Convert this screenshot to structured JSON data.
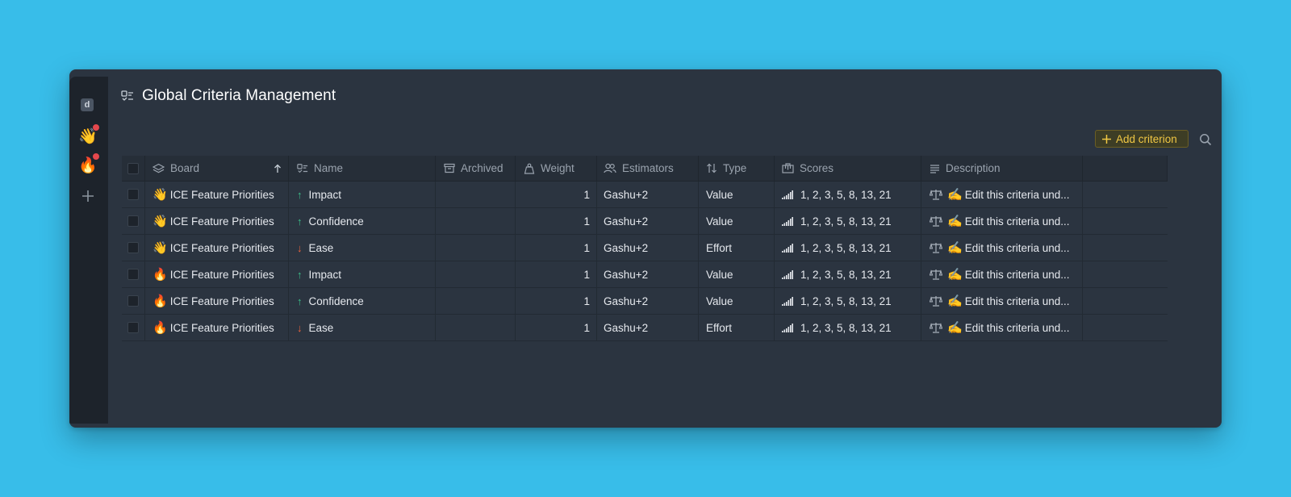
{
  "sidebar": {
    "logo_letter": "d",
    "boards": [
      {
        "emoji": "👋",
        "has_notification": true
      },
      {
        "emoji": "🔥",
        "has_notification": true
      }
    ]
  },
  "header": {
    "title": "Global Criteria Management"
  },
  "toolbar": {
    "add_label": "Add criterion"
  },
  "table": {
    "columns": {
      "board": "Board",
      "name": "Name",
      "archived": "Archived",
      "weight": "Weight",
      "estimators": "Estimators",
      "type": "Type",
      "scores": "Scores",
      "description": "Description"
    },
    "rows": [
      {
        "board_emoji": "👋",
        "board": "ICE Feature Priorities",
        "direction": "up",
        "name": "Impact",
        "archived": "",
        "weight": "1",
        "estimators": "Gashu+2",
        "type": "Value",
        "scores": "1, 2, 3, 5, 8, 13, 21",
        "desc_emoji": "✍️",
        "description": "Edit this criteria und..."
      },
      {
        "board_emoji": "👋",
        "board": "ICE Feature Priorities",
        "direction": "up",
        "name": "Confidence",
        "archived": "",
        "weight": "1",
        "estimators": "Gashu+2",
        "type": "Value",
        "scores": "1, 2, 3, 5, 8, 13, 21",
        "desc_emoji": "✍️",
        "description": "Edit this criteria und..."
      },
      {
        "board_emoji": "👋",
        "board": "ICE Feature Priorities",
        "direction": "down",
        "name": "Ease",
        "archived": "",
        "weight": "1",
        "estimators": "Gashu+2",
        "type": "Effort",
        "scores": "1, 2, 3, 5, 8, 13, 21",
        "desc_emoji": "✍️",
        "description": "Edit this criteria und..."
      },
      {
        "board_emoji": "🔥",
        "board": "ICE Feature Priorities",
        "direction": "up",
        "name": "Impact",
        "archived": "",
        "weight": "1",
        "estimators": "Gashu+2",
        "type": "Value",
        "scores": "1, 2, 3, 5, 8, 13, 21",
        "desc_emoji": "✍️",
        "description": "Edit this criteria und..."
      },
      {
        "board_emoji": "🔥",
        "board": "ICE Feature Priorities",
        "direction": "up",
        "name": "Confidence",
        "archived": "",
        "weight": "1",
        "estimators": "Gashu+2",
        "type": "Value",
        "scores": "1, 2, 3, 5, 8, 13, 21",
        "desc_emoji": "✍️",
        "description": "Edit this criteria und..."
      },
      {
        "board_emoji": "🔥",
        "board": "ICE Feature Priorities",
        "direction": "down",
        "name": "Ease",
        "archived": "",
        "weight": "1",
        "estimators": "Gashu+2",
        "type": "Effort",
        "scores": "1, 2, 3, 5, 8, 13, 21",
        "desc_emoji": "✍️",
        "description": "Edit this criteria und..."
      }
    ]
  },
  "colors": {
    "background": "#38bde9",
    "panel": "#2b3440",
    "rail": "#1d232b",
    "accent": "#f0c744",
    "arrow_up": "#3cc08a",
    "arrow_down": "#f0643c",
    "notification": "#e5484d"
  },
  "icons": {
    "board_column": "layers-icon",
    "name_column": "criteria-icon",
    "archived_column": "archive-box-icon",
    "weight_column": "weight-icon",
    "estimators_column": "users-icon",
    "type_column": "sort-arrows-icon",
    "scores_column": "ruler-icon",
    "description_column": "text-lines-icon",
    "sort_indicator": "arrow-up-icon",
    "add": "plus-icon",
    "search": "search-icon",
    "scores_cell": "signal-bars-icon",
    "description_cell": "scales-icon"
  }
}
